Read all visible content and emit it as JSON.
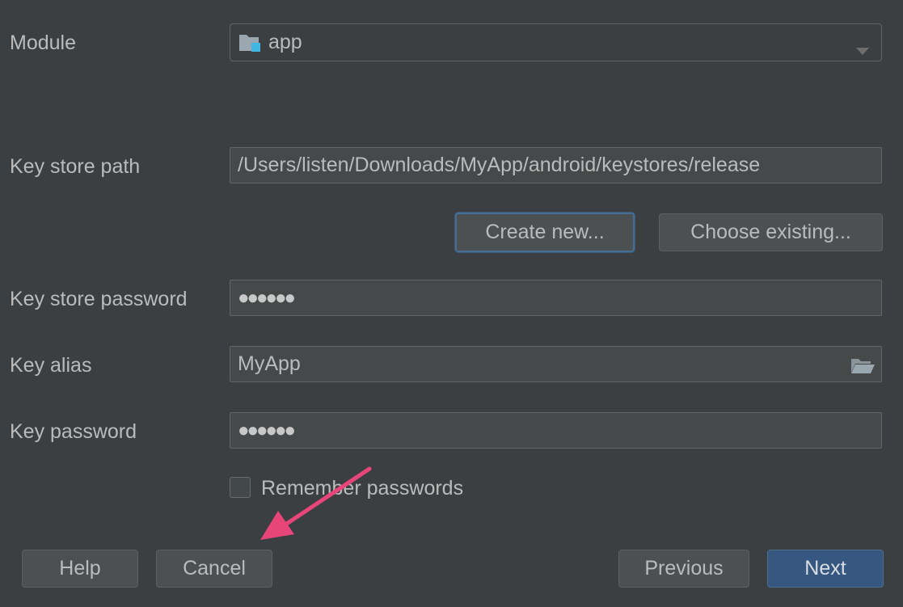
{
  "module": {
    "label": "Module",
    "value": "app",
    "icon": "folder-module-icon"
  },
  "keystore_path": {
    "label": "Key store path",
    "value": "/Users/listen/Downloads/MyApp/android/keystores/release"
  },
  "keystore_buttons": {
    "create_new": "Create new...",
    "choose_existing": "Choose existing..."
  },
  "keystore_password": {
    "label": "Key store password",
    "masked_value": "●●●●●●"
  },
  "key_alias": {
    "label": "Key alias",
    "value": "MyApp",
    "icon": "open-folder-icon"
  },
  "key_password": {
    "label": "Key password",
    "masked_value": "●●●●●●"
  },
  "remember": {
    "label": "Remember passwords",
    "checked": false
  },
  "footer": {
    "help": "Help",
    "cancel": "Cancel",
    "previous": "Previous",
    "next": "Next"
  },
  "colors": {
    "background": "#3c3f41",
    "field_bg": "#45494a",
    "primary_button": "#365880",
    "annotation_arrow": "#e8457a"
  }
}
